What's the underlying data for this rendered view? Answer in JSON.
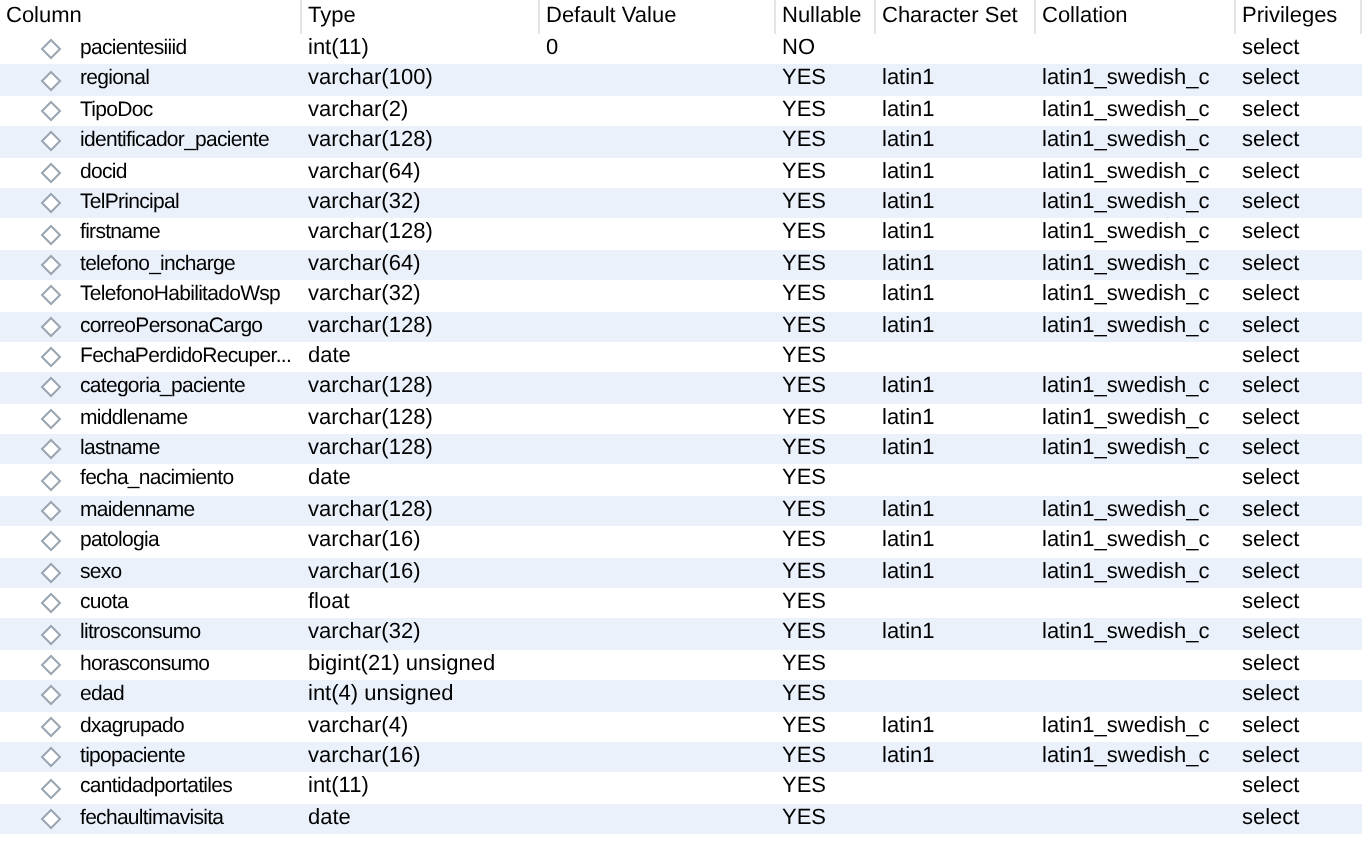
{
  "columns": [
    "Column",
    "Type",
    "Default Value",
    "Nullable",
    "Character Set",
    "Collation",
    "Privileges"
  ],
  "rows": [
    {
      "name": "pacientesiiid",
      "type": "int(11)",
      "default": "0",
      "nullable": "NO",
      "privileges": "select"
    },
    {
      "name": "regional",
      "type": "varchar(100)",
      "nullable": "YES",
      "charset": "latin1",
      "collation": "latin1_swedish_c",
      "privileges": "select"
    },
    {
      "name": "TipoDoc",
      "type": "varchar(2)",
      "nullable": "YES",
      "charset": "latin1",
      "collation": "latin1_swedish_c",
      "privileges": "select"
    },
    {
      "name": "identificador_paciente",
      "type": "varchar(128)",
      "nullable": "YES",
      "charset": "latin1",
      "collation": "latin1_swedish_c",
      "privileges": "select"
    },
    {
      "name": "docid",
      "type": "varchar(64)",
      "nullable": "YES",
      "charset": "latin1",
      "collation": "latin1_swedish_c",
      "privileges": "select"
    },
    {
      "name": "TelPrincipal",
      "type": "varchar(32)",
      "nullable": "YES",
      "charset": "latin1",
      "collation": "latin1_swedish_c",
      "privileges": "select"
    },
    {
      "name": "firstname",
      "type": "varchar(128)",
      "nullable": "YES",
      "charset": "latin1",
      "collation": "latin1_swedish_c",
      "privileges": "select"
    },
    {
      "name": "telefono_incharge",
      "type": "varchar(64)",
      "nullable": "YES",
      "charset": "latin1",
      "collation": "latin1_swedish_c",
      "privileges": "select"
    },
    {
      "name": "TelefonoHabilitadoWsp",
      "type": "varchar(32)",
      "nullable": "YES",
      "charset": "latin1",
      "collation": "latin1_swedish_c",
      "privileges": "select"
    },
    {
      "name": "correoPersonaCargo",
      "type": "varchar(128)",
      "nullable": "YES",
      "charset": "latin1",
      "collation": "latin1_swedish_c",
      "privileges": "select"
    },
    {
      "name": "FechaPerdidoRecuper...",
      "type": "date",
      "nullable": "YES",
      "privileges": "select"
    },
    {
      "name": "categoria_paciente",
      "type": "varchar(128)",
      "nullable": "YES",
      "charset": "latin1",
      "collation": "latin1_swedish_c",
      "privileges": "select"
    },
    {
      "name": "middlename",
      "type": "varchar(128)",
      "nullable": "YES",
      "charset": "latin1",
      "collation": "latin1_swedish_c",
      "privileges": "select"
    },
    {
      "name": "lastname",
      "type": "varchar(128)",
      "nullable": "YES",
      "charset": "latin1",
      "collation": "latin1_swedish_c",
      "privileges": "select"
    },
    {
      "name": "fecha_nacimiento",
      "type": "date",
      "nullable": "YES",
      "privileges": "select"
    },
    {
      "name": "maidenname",
      "type": "varchar(128)",
      "nullable": "YES",
      "charset": "latin1",
      "collation": "latin1_swedish_c",
      "privileges": "select"
    },
    {
      "name": "patologia",
      "type": "varchar(16)",
      "nullable": "YES",
      "charset": "latin1",
      "collation": "latin1_swedish_c",
      "privileges": "select"
    },
    {
      "name": "sexo",
      "type": "varchar(16)",
      "nullable": "YES",
      "charset": "latin1",
      "collation": "latin1_swedish_c",
      "privileges": "select"
    },
    {
      "name": "cuota",
      "type": "float",
      "nullable": "YES",
      "privileges": "select"
    },
    {
      "name": "litrosconsumo",
      "type": "varchar(32)",
      "nullable": "YES",
      "charset": "latin1",
      "collation": "latin1_swedish_c",
      "privileges": "select"
    },
    {
      "name": "horasconsumo",
      "type": "bigint(21) unsigned",
      "nullable": "YES",
      "privileges": "select"
    },
    {
      "name": "edad",
      "type": "int(4) unsigned",
      "nullable": "YES",
      "privileges": "select"
    },
    {
      "name": "dxagrupado",
      "type": "varchar(4)",
      "nullable": "YES",
      "charset": "latin1",
      "collation": "latin1_swedish_c",
      "privileges": "select"
    },
    {
      "name": "tipopaciente",
      "type": "varchar(16)",
      "nullable": "YES",
      "charset": "latin1",
      "collation": "latin1_swedish_c",
      "privileges": "select"
    },
    {
      "name": "cantidadportatiles",
      "type": "int(11)",
      "nullable": "YES",
      "privileges": "select"
    },
    {
      "name": "fechaultimavisita",
      "type": "date",
      "nullable": "YES",
      "privileges": "select"
    }
  ]
}
